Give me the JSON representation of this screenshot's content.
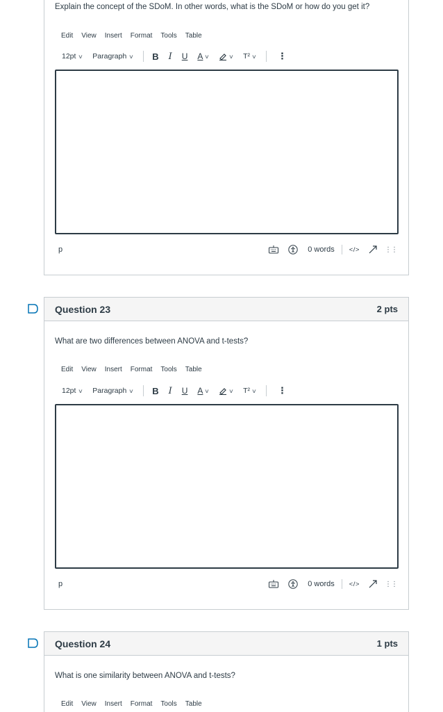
{
  "editor_labels": {
    "menu": [
      "Edit",
      "View",
      "Insert",
      "Format",
      "Tools",
      "Table"
    ],
    "font_size": "12pt",
    "block_format": "Paragraph",
    "bold": "B",
    "italic": "I",
    "underline": "U",
    "text_color": "A",
    "superscript": "T²",
    "more": "⋮",
    "path": "p",
    "word_count": "0 words",
    "html_toggle": "</>"
  },
  "questions": [
    {
      "text": "Explain the concept of the SDoM.  In other words, what is the SDoM or how do you get it?"
    },
    {
      "title": "Question 23",
      "points": "2 pts",
      "text": "What are two differences between ANOVA and t-tests?"
    },
    {
      "title": "Question 24",
      "points": "1 pts",
      "text": "What is one similarity between ANOVA and t-tests?"
    }
  ],
  "colors": {
    "accent": "#0374b5",
    "text": "#2d3b45",
    "border": "#c7cdd1",
    "header_bg": "#f5f5f5"
  }
}
